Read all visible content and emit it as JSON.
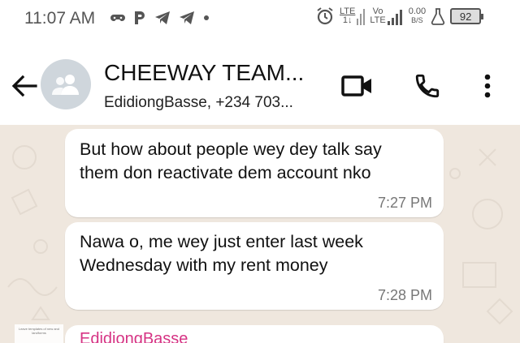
{
  "status_bar": {
    "time": "11:07 AM",
    "left_icons": [
      "game-controller-icon",
      "p-icon",
      "telegram-icon",
      "telegram-icon",
      "dot-icon"
    ],
    "network1": "LTE",
    "network1_sub": "1↓",
    "network2": "Vo",
    "network2_sub": "LTE",
    "speed_value": "0.00",
    "speed_unit": "B/S",
    "battery": "92"
  },
  "header": {
    "title": "CHEEWAY TEAM...",
    "subtitle": "EdidiongBasse, +234 703..."
  },
  "messages": [
    {
      "text": "But how about people wey dey talk say\nthem don reactivate dem account nko",
      "time": "7:27 PM"
    },
    {
      "text": "Nawa o,  me wey just enter last week\nWednesday with my rent money",
      "time": "7:28 PM"
    }
  ],
  "partial_message": {
    "sender": "EdidiongBasse"
  },
  "thumbnail_caption": "Leave templates of new and landforms",
  "colors": {
    "background": "#efe7de",
    "sender_name": "#d63384",
    "header_bg": "#ffffff"
  }
}
